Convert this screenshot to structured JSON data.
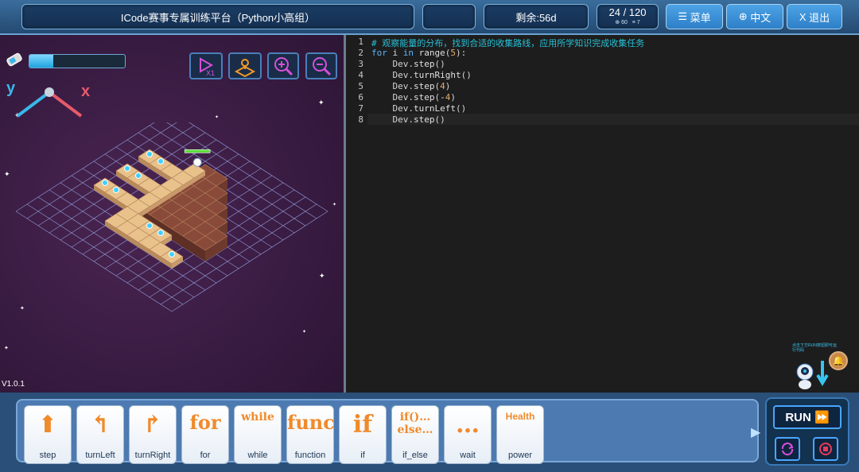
{
  "header": {
    "title": "ICode赛事专属训练平台（Python小高组）",
    "empty_box": "",
    "remaining": "剩余:56d",
    "progress": "24 / 120",
    "progress_sub_a": "60",
    "progress_sub_b": "7",
    "menu_label": "菜单",
    "lang_label": "中文",
    "exit_label": "退出",
    "menu_icon": "☰",
    "lang_icon": "⊕",
    "exit_icon": "X"
  },
  "game": {
    "version": "V1.0.1",
    "energy_level": 0.25,
    "axis_y": "y",
    "axis_x": "x",
    "tools": [
      "reset-play-icon",
      "map-icon",
      "zoom-in-icon",
      "zoom-out-icon"
    ]
  },
  "editor": {
    "lines": [
      {
        "n": "1",
        "text": "# 观察能量的分布，找到合适的收集路线，应用所学知识完成收集任务"
      },
      {
        "n": "2",
        "text": "for i in range(5):"
      },
      {
        "n": "3",
        "text": "    Dev.step()"
      },
      {
        "n": "4",
        "text": "    Dev.turnRight()"
      },
      {
        "n": "5",
        "text": "    Dev.step(4)"
      },
      {
        "n": "6",
        "text": "    Dev.step(-4)"
      },
      {
        "n": "7",
        "text": "    Dev.turnLeft()"
      },
      {
        "n": "8",
        "text": "    Dev.step()"
      }
    ]
  },
  "blocks": [
    {
      "label": "step",
      "glyph": "⬆"
    },
    {
      "label": "turnLeft",
      "glyph": "↰"
    },
    {
      "label": "turnRight",
      "glyph": "↱"
    },
    {
      "label": "for",
      "glyph": "for"
    },
    {
      "label": "while",
      "glyph": "while"
    },
    {
      "label": "function",
      "glyph": "func"
    },
    {
      "label": "if",
      "glyph": "if"
    },
    {
      "label": "if_else",
      "glyph": "if()…else…"
    },
    {
      "label": "wait",
      "glyph": "…"
    },
    {
      "label": "power",
      "glyph": "Health"
    }
  ],
  "run": {
    "run_label": "RUN",
    "hint": "点击下方RUN按钮即可运行代码"
  }
}
